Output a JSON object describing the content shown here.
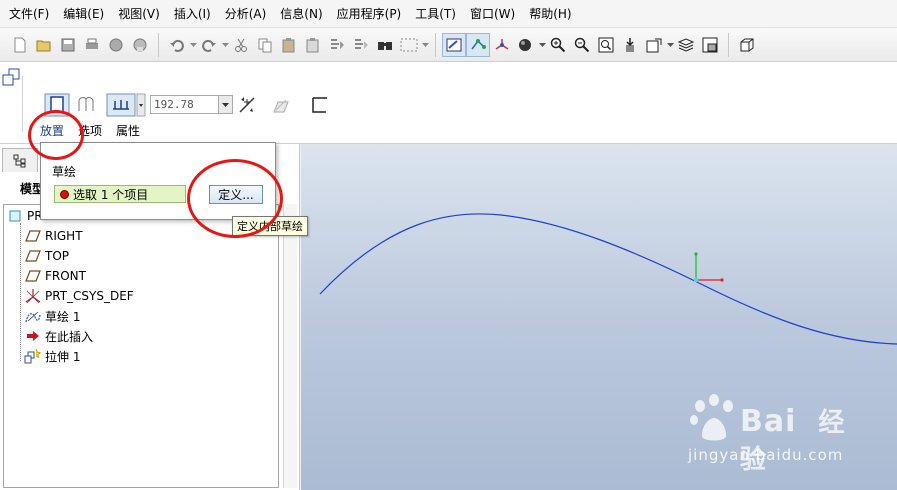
{
  "menubar": {
    "items": [
      "文件(F)",
      "编辑(E)",
      "视图(V)",
      "插入(I)",
      "分析(A)",
      "信息(N)",
      "应用程序(P)",
      "工具(T)",
      "窗口(W)",
      "帮助(H)"
    ]
  },
  "toolbar": {
    "icons": [
      "new-icon",
      "open-icon",
      "save-icon",
      "print-icon",
      "send-mail-icon",
      "mail-attach-icon",
      "undo-icon",
      "redo-icon",
      "cut-icon",
      "copy-icon",
      "paste-icon",
      "paste-special-icon",
      "regenerate-icon",
      "regen-manager-icon",
      "find-icon",
      "select-box-icon",
      "sketch-view-icon",
      "datum-points-icon",
      "csys-display-icon",
      "shading-icon",
      "zoom-in-icon",
      "zoom-out-icon",
      "refit-icon",
      "reorient-icon",
      "saved-views-icon",
      "layers-icon",
      "view-manager-icon",
      "box-view-icon"
    ]
  },
  "dashboard": {
    "depth_value": "192.78",
    "tabs": {
      "placement": "放置",
      "options": "选项",
      "properties": "属性"
    }
  },
  "placement_panel": {
    "title": "草绘",
    "collector_text": "选取 1 个项目",
    "define_button": "定义...",
    "tooltip": "定义内部草绘"
  },
  "model_tree": {
    "header": "模型",
    "root": "PR",
    "items": [
      {
        "label": "RIGHT",
        "icon": "datum-plane-icon"
      },
      {
        "label": "TOP",
        "icon": "datum-plane-icon"
      },
      {
        "label": "FRONT",
        "icon": "datum-plane-icon"
      },
      {
        "label": "PRT_CSYS_DEF",
        "icon": "csys-icon"
      },
      {
        "label": "草绘 1",
        "icon": "sketch-icon"
      },
      {
        "label": "在此插入",
        "icon": "insert-here-arrow-icon"
      },
      {
        "label": "拉伸 1",
        "icon": "extrude-icon"
      }
    ]
  },
  "watermark": {
    "brand": "Bai",
    "brand_cn": "经验",
    "url": "jingyan.baidu.com"
  },
  "colors": {
    "curve": "#1c3fd0",
    "annotation": "#e81515",
    "collector_bg": "#e3f5c4"
  }
}
